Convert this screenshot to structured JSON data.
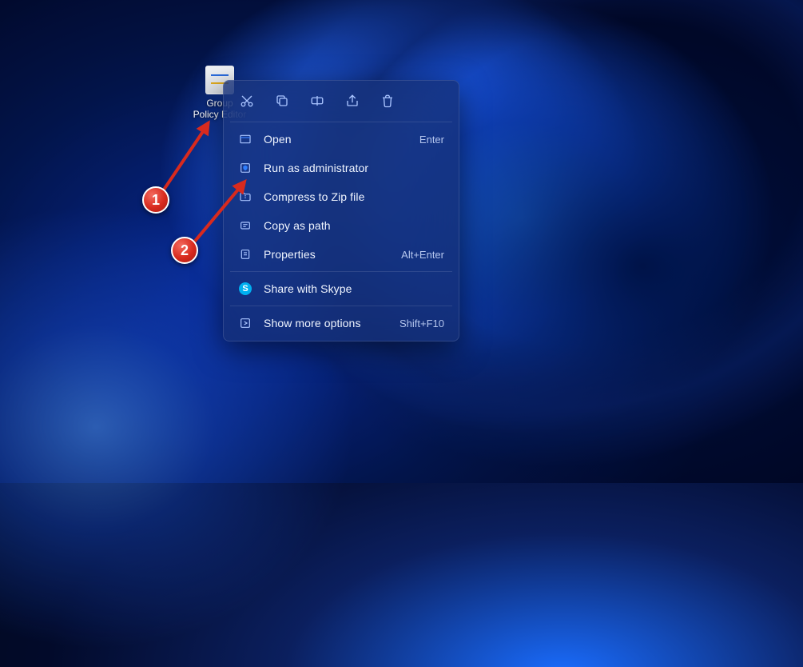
{
  "desktop": {
    "icon_label": "Group Policy Editor"
  },
  "topBar": {
    "items": [
      {
        "name": "cut-icon"
      },
      {
        "name": "copy-icon"
      },
      {
        "name": "rename-icon"
      },
      {
        "name": "share-icon"
      },
      {
        "name": "delete-icon"
      }
    ]
  },
  "menu": {
    "open": {
      "label": "Open",
      "accel": "Enter"
    },
    "runAdmin": {
      "label": "Run as administrator",
      "accel": ""
    },
    "zip": {
      "label": "Compress to Zip file",
      "accel": ""
    },
    "copyPath": {
      "label": "Copy as path",
      "accel": ""
    },
    "properties": {
      "label": "Properties",
      "accel": "Alt+Enter"
    },
    "skype": {
      "label": "Share with Skype",
      "accel": ""
    },
    "more": {
      "label": "Show more options",
      "accel": "Shift+F10"
    }
  },
  "annotations": {
    "badge1": "1",
    "badge2": "2"
  }
}
